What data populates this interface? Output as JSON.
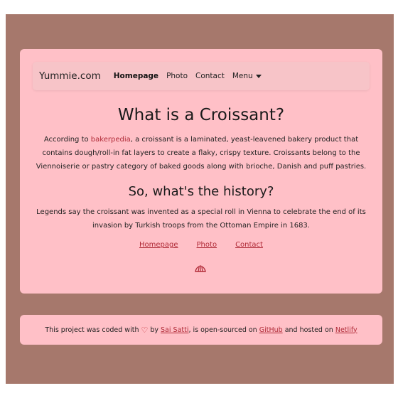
{
  "navbar": {
    "brand": "Yummie.com",
    "items": [
      {
        "label": "Homepage"
      },
      {
        "label": "Photo"
      },
      {
        "label": "Contact"
      },
      {
        "label": "Menu"
      }
    ]
  },
  "main": {
    "title": "What is a Croissant?",
    "intro_before": "According to ",
    "intro_link": "bakerpedia",
    "intro_after": ", a croissant is a laminated, yeast-leavened bakery product that contains dough/roll-in fat layers to create a flaky, crispy texture. Croissants belong to the Viennoiserie or pastry category of baked goods along with brioche, Danish and puff pastries.",
    "subtitle": "So, what's the history?",
    "history": "Legends say the croissant was invented as a special roll in Vienna to celebrate the end of its invasion by Turkish troops from the Ottoman Empire in 1683.",
    "links": [
      {
        "label": "Homepage"
      },
      {
        "label": "Photo"
      },
      {
        "label": "Contact"
      }
    ],
    "icon": "croissant-icon"
  },
  "footer": {
    "text_1": "This project was coded with",
    "heart_icon": "heart-icon",
    "text_2": "by",
    "author": "Sai Satti",
    "text_3": ", is open-sourced on",
    "github": "GitHub",
    "text_4": "and hosted on",
    "netlify": "Netlify"
  },
  "colors": {
    "page_bg": "#a6786c",
    "card_bg": "#ffc0c7",
    "link": "#b02a37"
  }
}
